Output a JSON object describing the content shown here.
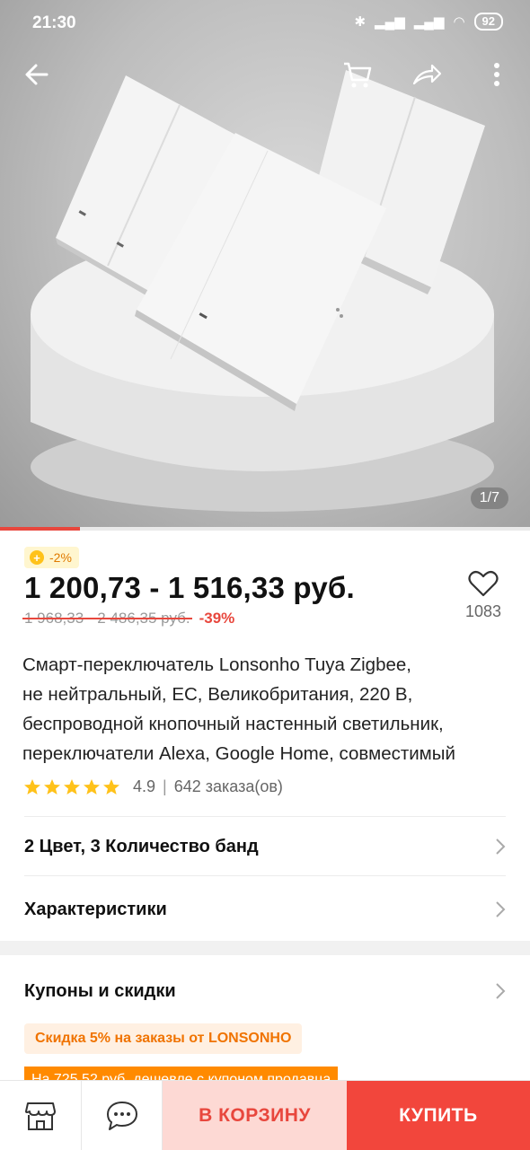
{
  "status": {
    "time": "21:30",
    "battery": "92"
  },
  "hero": {
    "counter": "1/7",
    "progress_fraction": 0.15
  },
  "price": {
    "badge": "-2%",
    "range": "1 200,73 - 1 516,33 руб.",
    "old_range": "1 968,33 - 2 486,35 руб.",
    "discount": "-39%"
  },
  "favorites": {
    "count": "1083"
  },
  "product": {
    "title_lines": [
      "Смарт-переключатель Lonsonho Tuya Zigbee,",
      "не нейтральный, ЕС, Великобритания, 220 В,",
      "беспроводной кнопочный настенный светильник,",
      "переключатели Alexa, Google Home, совместимый"
    ],
    "rating": "4.9",
    "stars": 5,
    "orders": "642 заказа(ов)"
  },
  "options": {
    "variant_label": "2 Цвет, 3 Количество банд",
    "specs_label": "Характеристики"
  },
  "coupons": {
    "heading": "Купоны и скидки",
    "coupon1": "Скидка 5% на заказы от LONSONHO",
    "coupon2": "На 725,52 руб. дешевле с купоном продавца"
  },
  "bottom": {
    "cart_label": "В КОРЗИНУ",
    "buy_label": "КУПИТЬ"
  },
  "icons": [
    "back-arrow-icon",
    "cart-icon",
    "share-icon",
    "more-icon",
    "heart-icon",
    "star-icon",
    "chevron-right-icon",
    "store-icon",
    "chat-icon"
  ],
  "colors": {
    "accent": "#f2463c",
    "cart_bg": "#fdd9d4",
    "coupon_orange": "#ff8a00",
    "star": "#ffc21a"
  }
}
